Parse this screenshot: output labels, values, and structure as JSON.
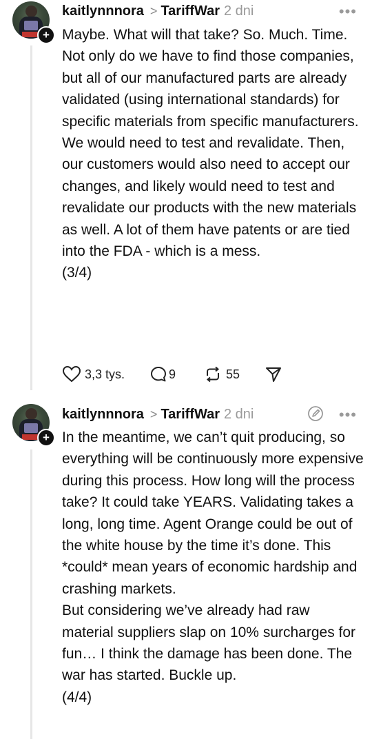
{
  "posts": [
    {
      "username": "kaitlynnnora",
      "separator": ">",
      "topic": "TariffWar",
      "time": "2 dni",
      "paragraphs": [
        "Maybe. What will that take? So. Much. Time.",
        "Not only do we have to find those companies, but all of our manufactured parts are already validated (using international standards) for specific materials from specific manufacturers. We would need to test and revalidate. Then, our customers would also need to accept our changes, and likely would need to test and revalidate our products with the new materials as well. A lot of them have patents or are tied into the FDA - which is a mess.",
        "(3/4)"
      ],
      "actions": {
        "likes": "3,3 tys.",
        "replies": "9",
        "reposts": "55"
      }
    },
    {
      "username": "kaitlynnnora",
      "separator": ">",
      "topic": "TariffWar",
      "time": "2 dni",
      "paragraphs": [
        "In the meantime, we can’t quit producing, so everything will be continuously more expensive during this process. How long will the process take? It could take YEARS. Validating takes a long, long time. Agent Orange could be out of the white house by the time it’s done. This *could* mean years of economic hardship and crashing markets.",
        "But considering we’ve already had raw material suppliers slap on 10% surcharges for fun… I think the damage has been done. The war has started. Buckle up.",
        "(4/4)"
      ]
    }
  ],
  "icons": {
    "avatar_badge": "plus-icon",
    "more": "more-horizontal-icon",
    "like": "heart-icon",
    "reply": "comment-icon",
    "repost": "repost-icon",
    "share": "send-icon",
    "edited": "edit-icon"
  },
  "more_glyph": "•••",
  "badge_glyph": "+"
}
